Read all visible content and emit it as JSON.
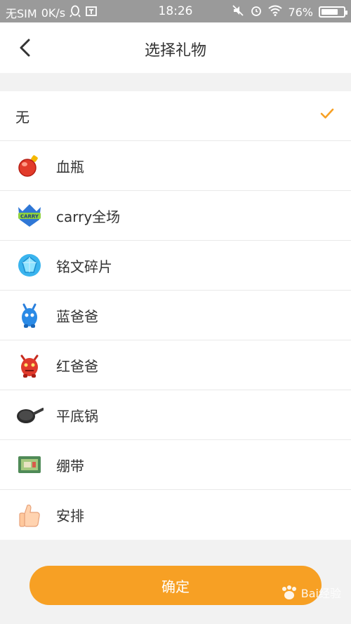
{
  "status_bar": {
    "carrier": "无SIM",
    "speed": "0K/s",
    "time": "18:26",
    "battery": "76%",
    "battery_level": 0.76
  },
  "header": {
    "title": "选择礼物",
    "back_icon": "chevron-left-icon"
  },
  "gifts": [
    {
      "label": "无",
      "icon": "",
      "selected": true
    },
    {
      "label": "血瓶",
      "icon": "potion-icon"
    },
    {
      "label": "carry全场",
      "icon": "carry-badge-icon"
    },
    {
      "label": "铭文碎片",
      "icon": "gem-icon"
    },
    {
      "label": "蓝爸爸",
      "icon": "blue-buff-icon"
    },
    {
      "label": "红爸爸",
      "icon": "red-buff-icon"
    },
    {
      "label": "平底锅",
      "icon": "pan-icon"
    },
    {
      "label": "绷带",
      "icon": "bandage-icon"
    },
    {
      "label": "安排",
      "icon": "thumbs-up-icon"
    }
  ],
  "confirm_label": "确定",
  "colors": {
    "accent": "#f7a024",
    "check": "#f7a024",
    "status_bar": "#9a9a9a"
  },
  "watermark": "Bai经验"
}
